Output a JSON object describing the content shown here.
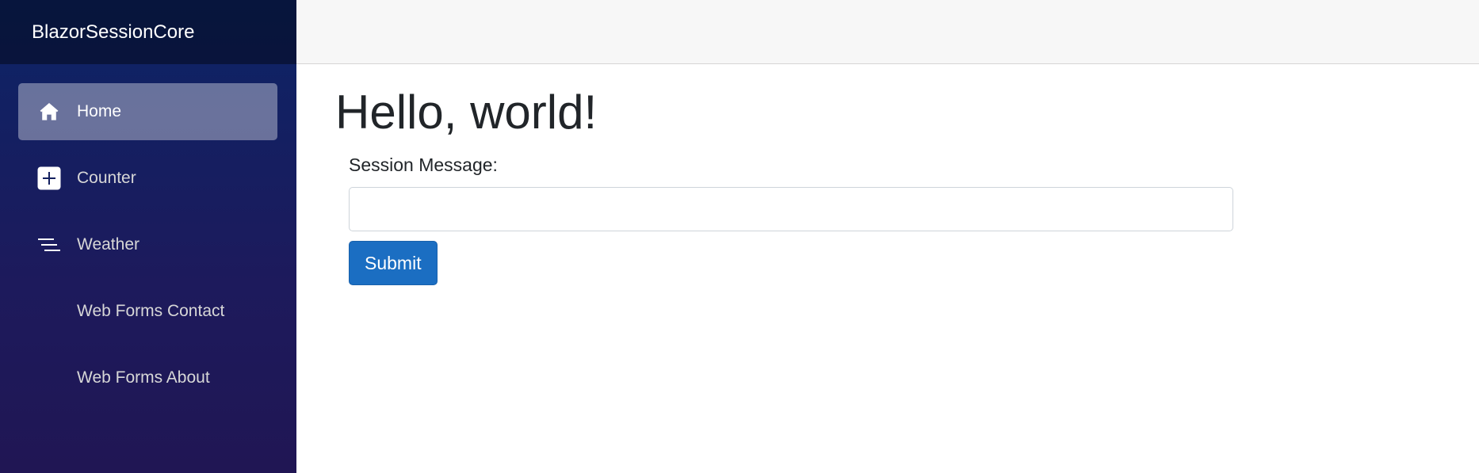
{
  "app": {
    "brand": "BlazorSessionCore"
  },
  "sidebar": {
    "items": [
      {
        "label": "Home",
        "icon": "home-icon",
        "active": true
      },
      {
        "label": "Counter",
        "icon": "plus-square-icon",
        "active": false
      },
      {
        "label": "Weather",
        "icon": "list-icon",
        "active": false
      },
      {
        "label": "Web Forms Contact",
        "icon": "",
        "active": false
      },
      {
        "label": "Web Forms About",
        "icon": "",
        "active": false
      }
    ]
  },
  "main": {
    "title": "Hello, world!",
    "form": {
      "label": "Session Message:",
      "input_value": "",
      "submit_label": "Submit"
    }
  },
  "colors": {
    "sidebar_top": "#0c2466",
    "sidebar_bottom": "#201654",
    "button_primary": "#1b6ec2",
    "top_row": "#f7f7f7"
  }
}
